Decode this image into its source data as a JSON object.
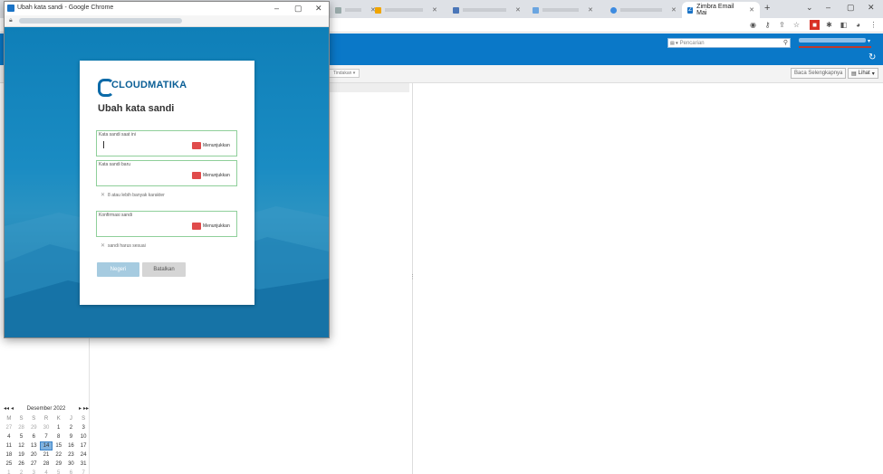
{
  "background_browser": {
    "tabs": [
      {
        "label": "",
        "active": false
      },
      {
        "label": "",
        "active": false
      },
      {
        "label": "",
        "active": false
      },
      {
        "label": "",
        "active": false
      },
      {
        "label": "",
        "active": false
      },
      {
        "label": "Zimbra Email Mai",
        "active": true
      }
    ],
    "new_tab": "+",
    "window_controls": [
      "⌄",
      "–",
      "▢",
      "✕"
    ]
  },
  "zimbra": {
    "search_placeholder": "Pencarian",
    "action_dropdown": "Tindakan",
    "read_more_button": "Baca Selengkapnya",
    "view_button": "Lihat"
  },
  "calendar": {
    "month_label": "Desember 2022",
    "nav": {
      "prev_year": "◂◂",
      "prev_month": "◂",
      "next_month": "▸",
      "next_year": "▸▸"
    },
    "weekdays": [
      "M",
      "S",
      "S",
      "R",
      "K",
      "J",
      "S"
    ],
    "weeks": [
      [
        {
          "d": "27",
          "o": true
        },
        {
          "d": "28",
          "o": true
        },
        {
          "d": "29",
          "o": true
        },
        {
          "d": "30",
          "o": true
        },
        {
          "d": "1"
        },
        {
          "d": "2"
        },
        {
          "d": "3"
        }
      ],
      [
        {
          "d": "4"
        },
        {
          "d": "5"
        },
        {
          "d": "6"
        },
        {
          "d": "7"
        },
        {
          "d": "8"
        },
        {
          "d": "9"
        },
        {
          "d": "10"
        }
      ],
      [
        {
          "d": "11"
        },
        {
          "d": "12"
        },
        {
          "d": "13"
        },
        {
          "d": "14",
          "t": true
        },
        {
          "d": "15"
        },
        {
          "d": "16"
        },
        {
          "d": "17"
        }
      ],
      [
        {
          "d": "18"
        },
        {
          "d": "19"
        },
        {
          "d": "20"
        },
        {
          "d": "21"
        },
        {
          "d": "22"
        },
        {
          "d": "23"
        },
        {
          "d": "24"
        }
      ],
      [
        {
          "d": "25"
        },
        {
          "d": "26"
        },
        {
          "d": "27"
        },
        {
          "d": "28"
        },
        {
          "d": "29"
        },
        {
          "d": "30"
        },
        {
          "d": "31"
        }
      ],
      [
        {
          "d": "1",
          "o": true
        },
        {
          "d": "2",
          "o": true
        },
        {
          "d": "3",
          "o": true
        },
        {
          "d": "4",
          "o": true
        },
        {
          "d": "5",
          "o": true
        },
        {
          "d": "6",
          "o": true
        },
        {
          "d": "7",
          "o": true
        }
      ]
    ]
  },
  "popup": {
    "window_title": "Ubah kata sandi - Google Chrome",
    "window_controls": [
      "–",
      "▢",
      "✕"
    ],
    "logo_text": "CLOUDMATIKA",
    "title": "Ubah kata sandi",
    "fields": {
      "current": {
        "label": "Kata sandi saat ini",
        "value": "",
        "show_label": "Menunjukkan"
      },
      "new": {
        "label": "Kata sandi baru",
        "value": "",
        "show_label": "Menunjukkan"
      },
      "confirm": {
        "label": "Konfirmasi sandi",
        "value": "",
        "show_label": "Menunjukkan"
      }
    },
    "hints": {
      "length": "8 atau lebih banyak karakter",
      "match": "sandi harus sesuai"
    },
    "buttons": {
      "submit": "Negeri",
      "cancel": "Batalkan"
    },
    "show_icon_text": "eye"
  },
  "colors": {
    "zimbra_blue": "#0a78c8",
    "popup_gradient_top": "#0f7fb8",
    "field_border": "#8fcf9a",
    "show_icon": "#e04b4b",
    "submit_button": "#a6cbe0"
  }
}
